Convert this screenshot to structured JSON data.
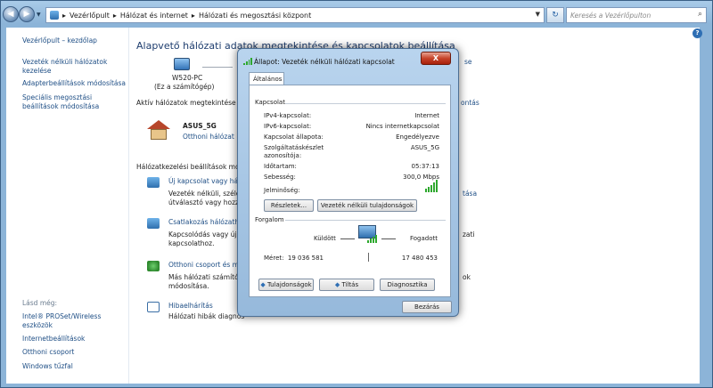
{
  "address": {
    "crumbs": [
      "Vezérlőpult",
      "Hálózat és internet",
      "Hálózati és megosztási központ"
    ],
    "search_placeholder": "Keresés a Vezérlőpulton"
  },
  "sidebar": {
    "home": "Vezérlőpult – kezdőlap",
    "items": [
      "Vezeték nélküli hálózatok kezelése",
      "Adapterbeállítások módosítása",
      "Speciális megosztási beállítások módosítása"
    ],
    "see_also_header": "Lásd még:",
    "see_also": [
      "Intel® PROSet/Wireless eszközök",
      "Internetbeállítások",
      "Otthoni csoport",
      "Windows tűzfal"
    ]
  },
  "main": {
    "title": "Alapvető hálózati adatok megtekintése és kapcsolatok beállítása",
    "computer_name": "W520-PC",
    "computer_sub": "(Ez a számítógép)",
    "map_link_fragment": "se",
    "active_header": "Aktív hálózatok megtekintése",
    "active_right_fragment": "ontás",
    "network_name": "ASUS_5G",
    "network_type": "Otthoni hálózat",
    "settings_header": "Hálózatkezelési beállítások módo",
    "tasks": [
      {
        "link": "Új kapcsolat vagy hálóz",
        "desc": "Vezeték nélküli, széless",
        "desc2": "útválasztó vagy hozzáf",
        "right": "tása"
      },
      {
        "link": "Csatlakozás hálózathoz",
        "desc": "Kapcsolódás vagy újrak",
        "desc2": "kapcsolathoz.",
        "right": "zati"
      },
      {
        "link": "Otthoni csoport és meg",
        "desc": "Más hálózati számítóge",
        "desc2": "módosítása.",
        "right": "ok"
      },
      {
        "link": "Hibaelhárítás",
        "desc": "Hálózati hibák diagnos",
        "desc2": "",
        "right": ""
      }
    ]
  },
  "dialog": {
    "title": "Állapot: Vezeték nélküli hálózati kapcsolat",
    "close_glyph": "X",
    "tab": "Általános",
    "connection_header": "Kapcsolat",
    "rows": [
      {
        "label": "IPv4-kapcsolat:",
        "value": "Internet"
      },
      {
        "label": "IPv6-kapcsolat:",
        "value": "Nincs internetkapcsolat"
      },
      {
        "label": "Kapcsolat állapota:",
        "value": "Engedélyezve"
      },
      {
        "label": "Szolgáltatáskészlet azonosítója:",
        "value": "ASUS_5G"
      },
      {
        "label": "Időtartam:",
        "value": "05:37:13"
      },
      {
        "label": "Sebesség:",
        "value": "300,0 Mbps"
      }
    ],
    "signal_label": "Jelminőség:",
    "details_button": "Részletek...",
    "wireless_props_button": "Vezeték nélküli tulajdonságok",
    "traffic_header": "Forgalom",
    "sent_label": "Küldött",
    "received_label": "Fogadott",
    "bytes_label": "Méret:",
    "sent_bytes": "19 036 581",
    "received_bytes": "17 480 453",
    "properties_button": "Tulajdonságok",
    "disable_button": "Tiltás",
    "diagnose_button": "Diagnosztika",
    "close_button": "Bezárás"
  },
  "colors": {
    "link": "#1e4e85",
    "accent": "#2ea82e",
    "close": "#c7442b"
  }
}
